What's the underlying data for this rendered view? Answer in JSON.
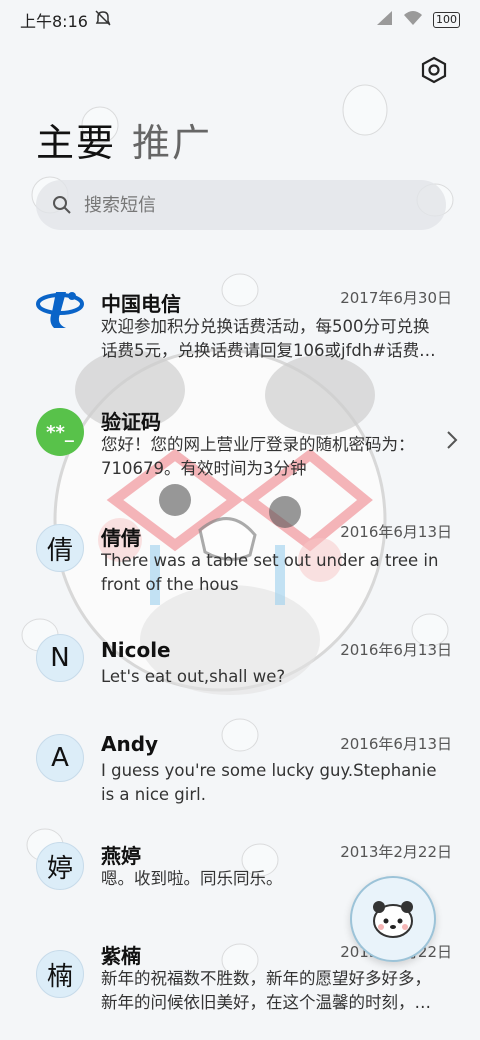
{
  "status_bar": {
    "time": "上午8:16",
    "battery": "100",
    "icons": [
      "mute-icon",
      "signal-icon",
      "wifi-icon",
      "battery-icon"
    ]
  },
  "tabs": [
    {
      "label": "主要",
      "active": true
    },
    {
      "label": "推广",
      "active": false
    }
  ],
  "search": {
    "placeholder": "搜索短信"
  },
  "conversations": [
    {
      "name": "中国电信",
      "date": "2017年6月30日",
      "avatar_type": "logo",
      "avatar_text": "",
      "line1": "欢迎参加积分兑换话费活动，每500分可兑换",
      "line2": "话费5元，兑换话费请回复106或jfdh#话费…"
    },
    {
      "name": "验证码",
      "date": "",
      "avatar_type": "code",
      "avatar_text": "**_",
      "line1": "您好！您的网上营业厅登录的随机密码为：",
      "line2": "710679。有效时间为3分钟"
    },
    {
      "name": "倩倩",
      "date": "2016年6月13日",
      "avatar_type": "letter",
      "avatar_text": "倩",
      "line1": "There was a table set out under a tree in",
      "line2": "front of the hous"
    },
    {
      "name": "Nicole",
      "date": "2016年6月13日",
      "avatar_type": "letter",
      "avatar_text": "N",
      "line1": "Let's eat out,shall we?",
      "line2": ""
    },
    {
      "name": "Andy",
      "date": "2016年6月13日",
      "avatar_type": "letter",
      "avatar_text": "A",
      "line1": "I guess you're some lucky guy.Stephanie",
      "line2": "is a nice girl."
    },
    {
      "name": "燕婷",
      "date": "2013年2月22日",
      "avatar_type": "letter",
      "avatar_text": "婷",
      "line1": "嗯。收到啦。同乐同乐。",
      "line2": ""
    },
    {
      "name": "紫楠",
      "date": "2013年2月22日",
      "avatar_type": "letter",
      "avatar_text": "楠",
      "line1": "新年的祝福数不胜数，新年的愿望好多好多，",
      "line2": "新年的问候依旧美好，在这个温馨的时刻，…"
    }
  ],
  "colors": {
    "code_avatar": "#58c24a",
    "telecom_blue": "#0a64c8",
    "letter_avatar": "#dcedf8"
  }
}
